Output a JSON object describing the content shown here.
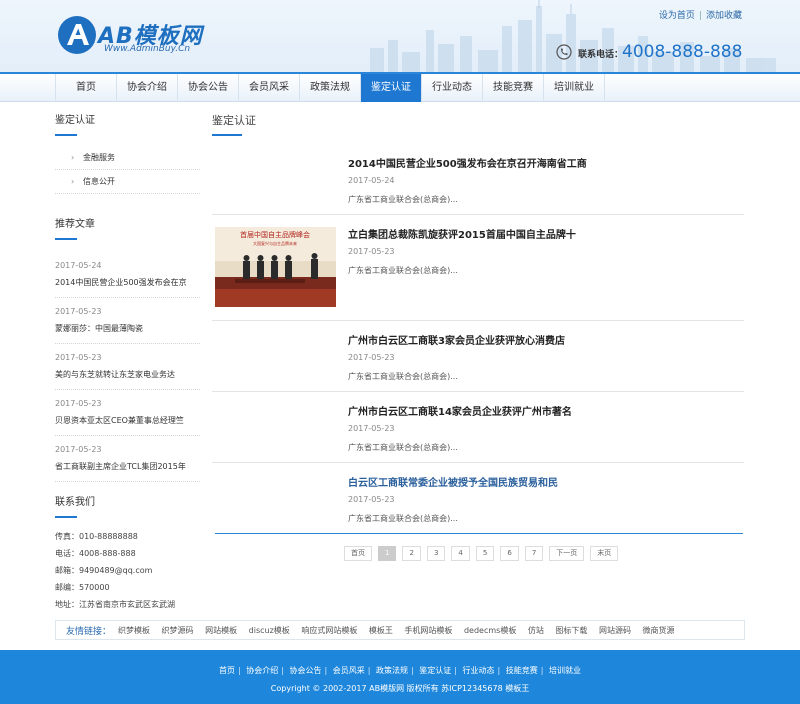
{
  "header": {
    "logo_title": "AB模板网",
    "logo_url": "Www.AdminBuy.Cn",
    "top_links": [
      "设为首页",
      "添加收藏"
    ],
    "phone_label": "联系电话：",
    "phone_number": "4008-888-888"
  },
  "nav": {
    "items": [
      "首页",
      "协会介绍",
      "协会公告",
      "会员风采",
      "政策法规",
      "鉴定认证",
      "行业动态",
      "技能竞赛",
      "培训就业"
    ],
    "active_index": 5
  },
  "sidebar": {
    "section_title": "鉴定认证",
    "sub_items": [
      "金融服务",
      "信息公开"
    ],
    "recommend_title": "推荐文章",
    "recommend": [
      {
        "date": "2017-05-24",
        "title": "2014中国民营企业500强发布会在京"
      },
      {
        "date": "2017-05-23",
        "title": "蒙娜丽莎：中国最薄陶瓷"
      },
      {
        "date": "2017-05-23",
        "title": "美的与东芝就转让东芝家电业务达"
      },
      {
        "date": "2017-05-23",
        "title": "贝恩资本亚太区CEO兼董事总经理竺"
      },
      {
        "date": "2017-05-23",
        "title": "省工商联副主席企业TCL集团2015年"
      }
    ],
    "contact_title": "联系我们",
    "contact": [
      "传真：010-88888888",
      "电话：4008-888-888",
      "邮箱：9490489@qq.com",
      "邮编：570000",
      "地址：江苏省南京市玄武区玄武湖"
    ]
  },
  "main": {
    "title": "鉴定认证",
    "articles": [
      {
        "title": "2014中国民营企业500强发布会在京召开海南省工商",
        "date": "2017-05-24",
        "source": "广东省工商业联合会(总商会)...",
        "has_thumb": false,
        "highlight": false
      },
      {
        "title": "立白集团总裁陈凯旋获评2015首届中国自主品牌十",
        "date": "2017-05-23",
        "source": "广东省工商业联合会(总商会)...",
        "has_thumb": true,
        "highlight": false
      },
      {
        "title": "广州市白云区工商联3家会员企业获评放心消费店",
        "date": "2017-05-23",
        "source": "广东省工商业联合会(总商会)...",
        "has_thumb": false,
        "highlight": false
      },
      {
        "title": "广州市白云区工商联14家会员企业获评广州市著名",
        "date": "2017-05-23",
        "source": "广东省工商业联合会(总商会)...",
        "has_thumb": false,
        "highlight": false
      },
      {
        "title": "白云区工商联常委企业被授予全国民族贸易和民",
        "date": "2017-05-23",
        "source": "广东省工商业联合会(总商会)...",
        "has_thumb": false,
        "highlight": true
      }
    ],
    "thumb_text_1": "首届中国自主品牌峰会",
    "thumb_text_2": "大国复兴与自主品牌未来"
  },
  "pager": {
    "first": "首页",
    "pages": [
      "1",
      "2",
      "3",
      "4",
      "5",
      "6",
      "7"
    ],
    "current": "1",
    "next": "下一页",
    "last": "末页"
  },
  "friend_links": {
    "label": "友情链接：",
    "items": [
      "织梦模板",
      "织梦源码",
      "网站模板",
      "discuz模板",
      "响应式网站模板",
      "模板王",
      "手机网站模板",
      "dedecms模板",
      "仿站",
      "图标下载",
      "网站源码",
      "微商货源"
    ]
  },
  "footer": {
    "nav": [
      "首页",
      "协会介绍",
      "协会公告",
      "会员风采",
      "政策法规",
      "鉴定认证",
      "行业动态",
      "技能竞赛",
      "培训就业"
    ],
    "copyright": "Copyright © 2002-2017 AB模版网 版权所有 苏ICP12345678  模板王"
  },
  "colors": {
    "accent": "#1e78d2",
    "footer_bg": "#1e87db",
    "link_blue": "#2a5f9c"
  }
}
